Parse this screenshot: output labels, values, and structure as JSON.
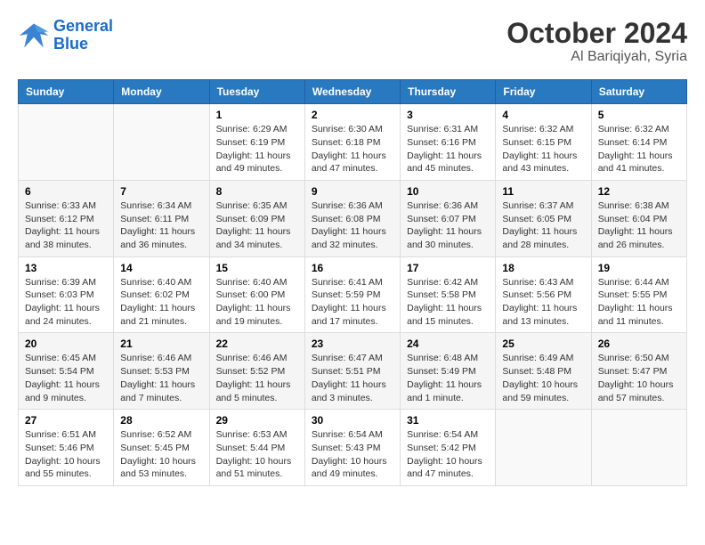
{
  "logo": {
    "line1": "General",
    "line2": "Blue"
  },
  "title": "October 2024",
  "subtitle": "Al Bariqiyah, Syria",
  "days_header": [
    "Sunday",
    "Monday",
    "Tuesday",
    "Wednesday",
    "Thursday",
    "Friday",
    "Saturday"
  ],
  "weeks": [
    [
      {
        "day": "",
        "info": ""
      },
      {
        "day": "",
        "info": ""
      },
      {
        "day": "1",
        "info": "Sunrise: 6:29 AM\nSunset: 6:19 PM\nDaylight: 11 hours and 49 minutes."
      },
      {
        "day": "2",
        "info": "Sunrise: 6:30 AM\nSunset: 6:18 PM\nDaylight: 11 hours and 47 minutes."
      },
      {
        "day": "3",
        "info": "Sunrise: 6:31 AM\nSunset: 6:16 PM\nDaylight: 11 hours and 45 minutes."
      },
      {
        "day": "4",
        "info": "Sunrise: 6:32 AM\nSunset: 6:15 PM\nDaylight: 11 hours and 43 minutes."
      },
      {
        "day": "5",
        "info": "Sunrise: 6:32 AM\nSunset: 6:14 PM\nDaylight: 11 hours and 41 minutes."
      }
    ],
    [
      {
        "day": "6",
        "info": "Sunrise: 6:33 AM\nSunset: 6:12 PM\nDaylight: 11 hours and 38 minutes."
      },
      {
        "day": "7",
        "info": "Sunrise: 6:34 AM\nSunset: 6:11 PM\nDaylight: 11 hours and 36 minutes."
      },
      {
        "day": "8",
        "info": "Sunrise: 6:35 AM\nSunset: 6:09 PM\nDaylight: 11 hours and 34 minutes."
      },
      {
        "day": "9",
        "info": "Sunrise: 6:36 AM\nSunset: 6:08 PM\nDaylight: 11 hours and 32 minutes."
      },
      {
        "day": "10",
        "info": "Sunrise: 6:36 AM\nSunset: 6:07 PM\nDaylight: 11 hours and 30 minutes."
      },
      {
        "day": "11",
        "info": "Sunrise: 6:37 AM\nSunset: 6:05 PM\nDaylight: 11 hours and 28 minutes."
      },
      {
        "day": "12",
        "info": "Sunrise: 6:38 AM\nSunset: 6:04 PM\nDaylight: 11 hours and 26 minutes."
      }
    ],
    [
      {
        "day": "13",
        "info": "Sunrise: 6:39 AM\nSunset: 6:03 PM\nDaylight: 11 hours and 24 minutes."
      },
      {
        "day": "14",
        "info": "Sunrise: 6:40 AM\nSunset: 6:02 PM\nDaylight: 11 hours and 21 minutes."
      },
      {
        "day": "15",
        "info": "Sunrise: 6:40 AM\nSunset: 6:00 PM\nDaylight: 11 hours and 19 minutes."
      },
      {
        "day": "16",
        "info": "Sunrise: 6:41 AM\nSunset: 5:59 PM\nDaylight: 11 hours and 17 minutes."
      },
      {
        "day": "17",
        "info": "Sunrise: 6:42 AM\nSunset: 5:58 PM\nDaylight: 11 hours and 15 minutes."
      },
      {
        "day": "18",
        "info": "Sunrise: 6:43 AM\nSunset: 5:56 PM\nDaylight: 11 hours and 13 minutes."
      },
      {
        "day": "19",
        "info": "Sunrise: 6:44 AM\nSunset: 5:55 PM\nDaylight: 11 hours and 11 minutes."
      }
    ],
    [
      {
        "day": "20",
        "info": "Sunrise: 6:45 AM\nSunset: 5:54 PM\nDaylight: 11 hours and 9 minutes."
      },
      {
        "day": "21",
        "info": "Sunrise: 6:46 AM\nSunset: 5:53 PM\nDaylight: 11 hours and 7 minutes."
      },
      {
        "day": "22",
        "info": "Sunrise: 6:46 AM\nSunset: 5:52 PM\nDaylight: 11 hours and 5 minutes."
      },
      {
        "day": "23",
        "info": "Sunrise: 6:47 AM\nSunset: 5:51 PM\nDaylight: 11 hours and 3 minutes."
      },
      {
        "day": "24",
        "info": "Sunrise: 6:48 AM\nSunset: 5:49 PM\nDaylight: 11 hours and 1 minute."
      },
      {
        "day": "25",
        "info": "Sunrise: 6:49 AM\nSunset: 5:48 PM\nDaylight: 10 hours and 59 minutes."
      },
      {
        "day": "26",
        "info": "Sunrise: 6:50 AM\nSunset: 5:47 PM\nDaylight: 10 hours and 57 minutes."
      }
    ],
    [
      {
        "day": "27",
        "info": "Sunrise: 6:51 AM\nSunset: 5:46 PM\nDaylight: 10 hours and 55 minutes."
      },
      {
        "day": "28",
        "info": "Sunrise: 6:52 AM\nSunset: 5:45 PM\nDaylight: 10 hours and 53 minutes."
      },
      {
        "day": "29",
        "info": "Sunrise: 6:53 AM\nSunset: 5:44 PM\nDaylight: 10 hours and 51 minutes."
      },
      {
        "day": "30",
        "info": "Sunrise: 6:54 AM\nSunset: 5:43 PM\nDaylight: 10 hours and 49 minutes."
      },
      {
        "day": "31",
        "info": "Sunrise: 6:54 AM\nSunset: 5:42 PM\nDaylight: 10 hours and 47 minutes."
      },
      {
        "day": "",
        "info": ""
      },
      {
        "day": "",
        "info": ""
      }
    ]
  ]
}
